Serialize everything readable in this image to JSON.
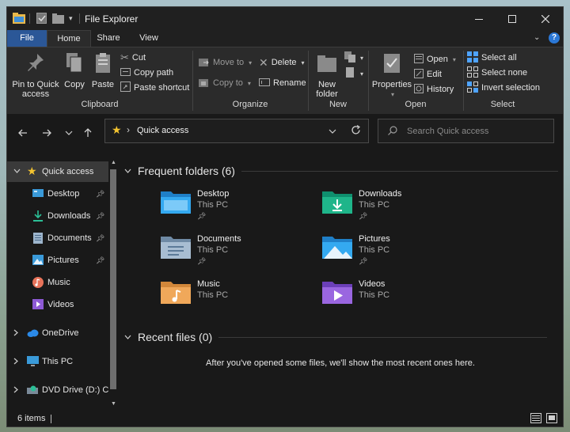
{
  "window": {
    "title": "File Explorer"
  },
  "ribbon_tabs": [
    "File",
    "Home",
    "Share",
    "View"
  ],
  "ribbon": {
    "clipboard": {
      "label": "Clipboard",
      "pin": "Pin to Quick access",
      "copy": "Copy",
      "paste": "Paste",
      "cut": "Cut",
      "copy_path": "Copy path",
      "paste_shortcut": "Paste shortcut"
    },
    "organize": {
      "label": "Organize",
      "move_to": "Move to",
      "copy_to": "Copy to",
      "delete": "Delete",
      "rename": "Rename"
    },
    "new": {
      "label": "New",
      "new_folder": "New folder"
    },
    "open": {
      "label": "Open",
      "properties": "Properties",
      "open": "Open",
      "edit": "Edit",
      "history": "History"
    },
    "select": {
      "label": "Select",
      "select_all": "Select all",
      "select_none": "Select none",
      "invert": "Invert selection"
    }
  },
  "address": {
    "location": "Quick access",
    "separator": "›"
  },
  "search": {
    "placeholder": "Search Quick access"
  },
  "sidebar": {
    "items": [
      {
        "label": "Quick access",
        "icon": "star-icon",
        "pinned": false
      },
      {
        "label": "Desktop",
        "icon": "desktop-icon",
        "pinned": true
      },
      {
        "label": "Downloads",
        "icon": "downloads-icon",
        "pinned": true
      },
      {
        "label": "Documents",
        "icon": "documents-icon",
        "pinned": true
      },
      {
        "label": "Pictures",
        "icon": "pictures-icon",
        "pinned": true
      },
      {
        "label": "Music",
        "icon": "music-icon",
        "pinned": false
      },
      {
        "label": "Videos",
        "icon": "videos-icon",
        "pinned": false
      },
      {
        "label": "OneDrive",
        "icon": "cloud-icon",
        "pinned": false
      },
      {
        "label": "This PC",
        "icon": "monitor-icon",
        "pinned": false
      },
      {
        "label": "DVD Drive (D:) CC",
        "icon": "dvd-icon",
        "pinned": false
      }
    ]
  },
  "frequent": {
    "title": "Frequent folders (6)",
    "folders": [
      {
        "name": "Desktop",
        "location": "This PC",
        "icon": "desktop-folder-icon",
        "pinned": true
      },
      {
        "name": "Downloads",
        "location": "This PC",
        "icon": "downloads-folder-icon",
        "pinned": true
      },
      {
        "name": "Documents",
        "location": "This PC",
        "icon": "documents-folder-icon",
        "pinned": true
      },
      {
        "name": "Pictures",
        "location": "This PC",
        "icon": "pictures-folder-icon",
        "pinned": true
      },
      {
        "name": "Music",
        "location": "This PC",
        "icon": "music-folder-icon",
        "pinned": false
      },
      {
        "name": "Videos",
        "location": "This PC",
        "icon": "videos-folder-icon",
        "pinned": false
      }
    ]
  },
  "recent": {
    "title": "Recent files (0)",
    "empty_message": "After you've opened some files, we'll show the most recent ones here."
  },
  "status": {
    "item_count": "6 items"
  },
  "colors": {
    "accent": "#2b5797",
    "background": "#191919",
    "ribbon": "#2b2b2b",
    "selected": "#3a3a3a"
  }
}
